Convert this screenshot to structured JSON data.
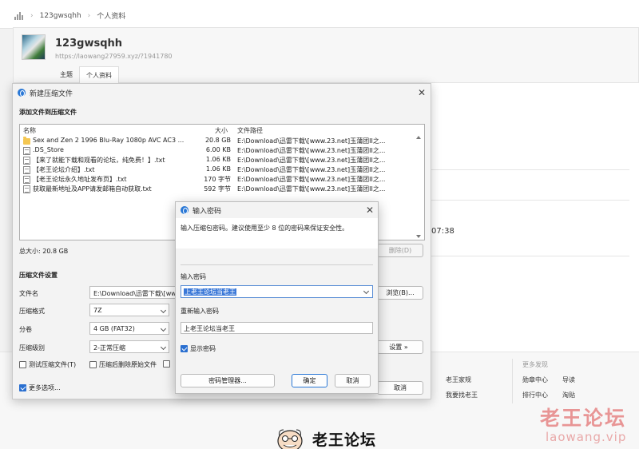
{
  "forum": {
    "breadcrumb": [
      "123gwsqhh",
      "个人资料"
    ],
    "username": "123gwsqhh",
    "profile_url": "https://laowang27959.xyz/?1941780",
    "tabs": [
      "主题",
      "个人资料"
    ],
    "time_fragment": "07:38",
    "footer": {
      "col_more": "更多发现",
      "links_left": [
        "老王家规",
        "我要找老王"
      ],
      "links_right": [
        [
          "勋章中心",
          "导读"
        ],
        [
          "排行中心",
          "淘贴"
        ]
      ]
    },
    "brand": "老王论坛",
    "watermark_cn": "老王论坛",
    "watermark_en": "laowang.vip"
  },
  "compress_dialog": {
    "title": "新建压缩文件",
    "close": "✕",
    "section_add": "添加文件到压缩文件",
    "columns": {
      "name": "名称",
      "size": "大小",
      "path": "文件路径"
    },
    "files": [
      {
        "icon": "folder",
        "name": "Sex and Zen 2 1996 Blu-Ray 1080p AVC AC3 ...",
        "size": "20.8 GB",
        "path": "E:\\Download\\迅雷下载\\[www.23.net]玉蒲团II之..."
      },
      {
        "icon": "doc",
        "name": ".DS_Store",
        "size": "6.00 KB",
        "path": "E:\\Download\\迅雷下载\\[www.23.net]玉蒲团II之..."
      },
      {
        "icon": "doc",
        "name": "【来了就能下载和观看的论坛，纯免费！】.txt",
        "size": "1.06 KB",
        "path": "E:\\Download\\迅雷下载\\[www.23.net]玉蒲团II之..."
      },
      {
        "icon": "doc",
        "name": "【老王论坛介绍】.txt",
        "size": "1.06 KB",
        "path": "E:\\Download\\迅雷下载\\[www.23.net]玉蒲团II之..."
      },
      {
        "icon": "doc",
        "name": "【老王论坛永久地址发布页】.txt",
        "size": "170 字节",
        "path": "E:\\Download\\迅雷下载\\[www.23.net]玉蒲团II之..."
      },
      {
        "icon": "doc",
        "name": "获取最新地址及APP请发邮箱自动获取.txt",
        "size": "592 字节",
        "path": "E:\\Download\\迅雷下载\\[www.23.net]玉蒲团II之..."
      }
    ],
    "total_size": "总大小: 20.8 GB",
    "delete_btn": "删除(D)",
    "section_settings": "压缩文件设置",
    "label_filename": "文件名",
    "filename_value": "E:\\Download\\迅雷下载\\[www",
    "browse_btn": "浏览(B)...",
    "label_format": "压缩格式",
    "format_value": "7Z",
    "label_volume": "分卷",
    "volume_value": "4 GB (FAT32)",
    "label_level": "压缩级别",
    "level_value": "2-正常压缩",
    "settings_btn": "设置 »",
    "chk_test": "测试压缩文件(T)",
    "chk_delete": "压缩后删除原始文件",
    "chk_more": "更多选项...",
    "cancel_btn": "取消"
  },
  "password_dialog": {
    "title": "输入密码",
    "close": "✕",
    "instruction": "输入压缩包密码。建议使用至少 8 位的密码来保证安全性。",
    "label_enter": "输入密码",
    "password_value": "上老王论坛当老王",
    "label_reenter": "重新输入密码",
    "reenter_value": "上老王论坛当老王",
    "chk_show": "显示密码",
    "manager_btn": "密码管理器...",
    "ok_btn": "确定",
    "cancel_btn": "取消"
  },
  "colors": {
    "accent": "#2a78d6",
    "watermark": "#dc4646",
    "folder": "#f4c752"
  }
}
